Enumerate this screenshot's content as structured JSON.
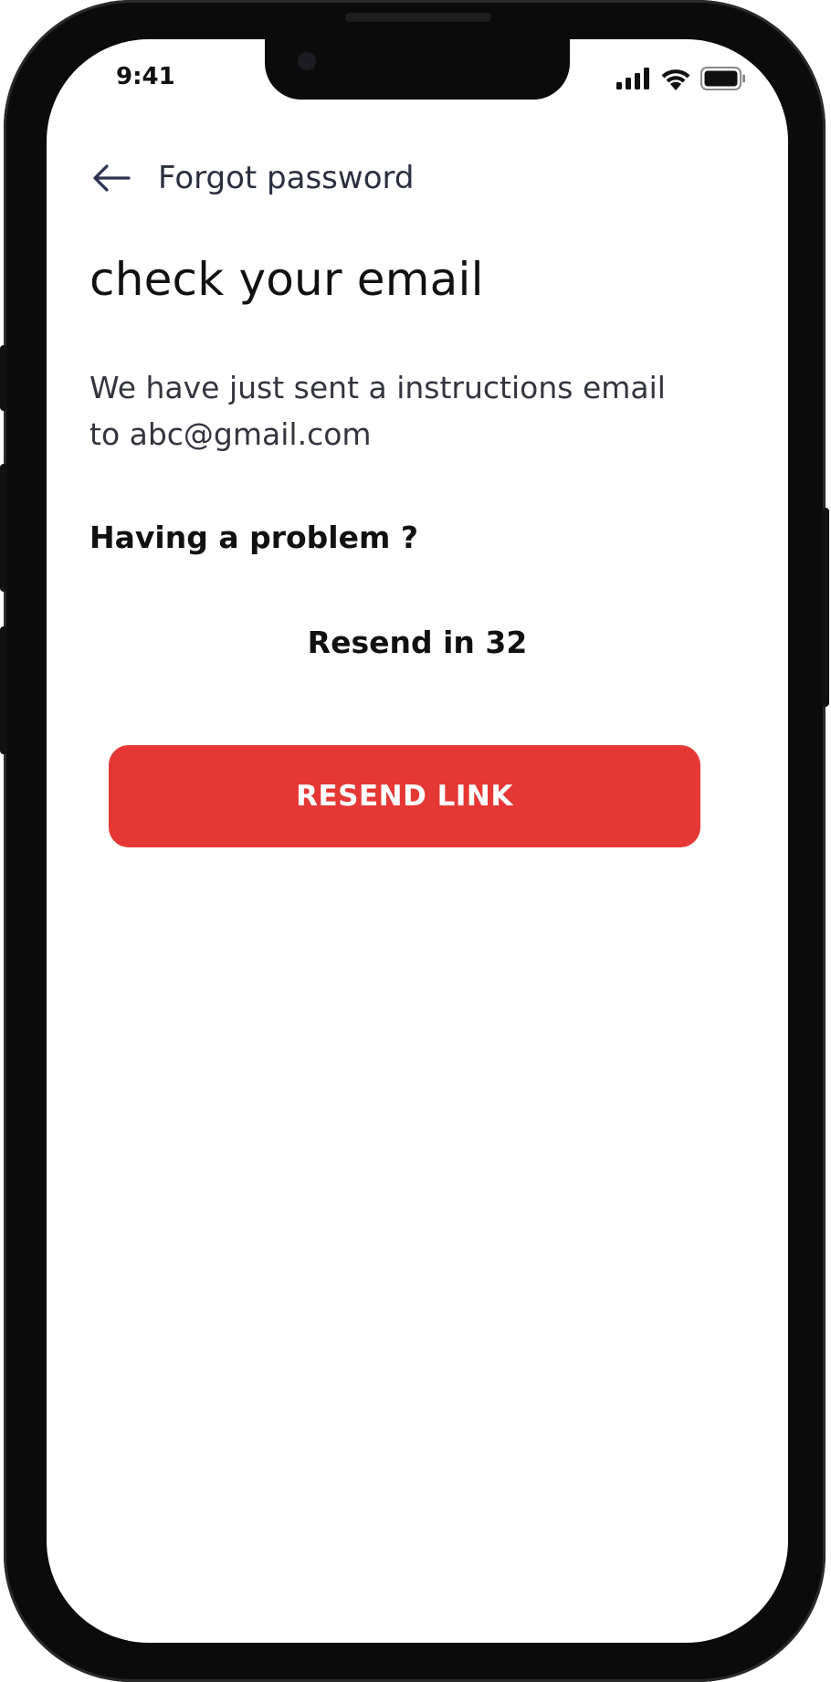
{
  "status_bar": {
    "time": "9:41"
  },
  "header": {
    "back_icon": "arrow-left-icon",
    "title": "Forgot password"
  },
  "main": {
    "heading": "check your email",
    "description": "We have just sent a instructions email to abc@gmail.com",
    "problem_label": "Having a problem ?",
    "resend_timer": "Resend in 32",
    "resend_button_label": "RESEND LINK"
  },
  "colors": {
    "accent": "#e53835",
    "text_dark": "#111111",
    "text_muted": "#33353f",
    "icon_navy": "#2b3150"
  }
}
